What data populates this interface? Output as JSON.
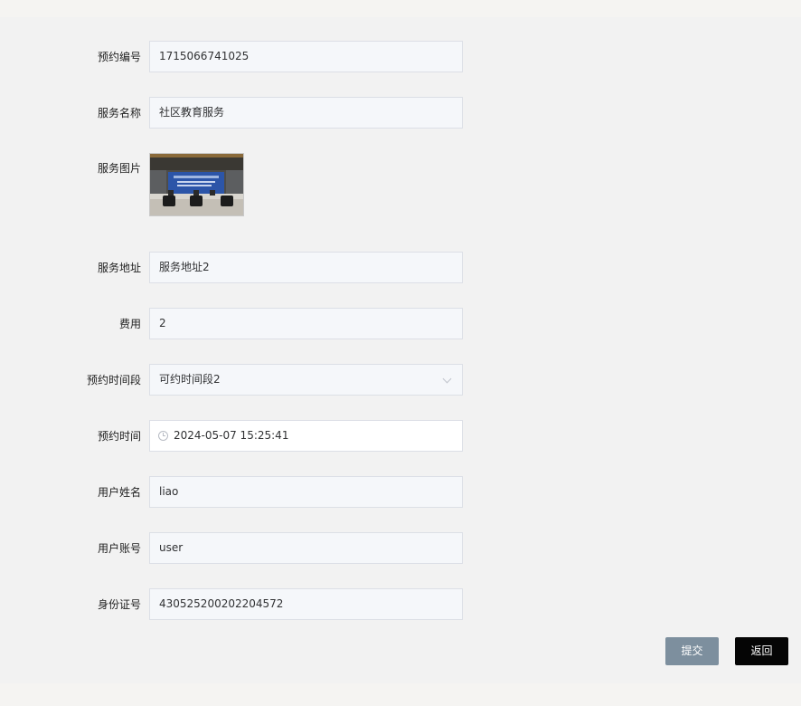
{
  "form": {
    "fields": [
      {
        "label": "预约编号",
        "value": "1715066741025"
      },
      {
        "label": "服务名称",
        "value": "社区教育服务"
      },
      {
        "label": "服务图片"
      },
      {
        "label": "服务地址",
        "value": "服务地址2"
      },
      {
        "label": "费用",
        "value": "2"
      },
      {
        "label": "预约时间段",
        "value": "可约时间段2"
      },
      {
        "label": "预约时间",
        "value": "2024-05-07 15:25:41"
      },
      {
        "label": "用户姓名",
        "value": "liao"
      },
      {
        "label": "用户账号",
        "value": "user"
      },
      {
        "label": "身份证号",
        "value": "430525200202204572"
      }
    ]
  },
  "actions": {
    "submit_label": "提交",
    "back_label": "返回"
  },
  "colors": {
    "submit": "#7d8f9e",
    "back": "#050505",
    "input_bg": "#f5f7fa",
    "input_border": "#dcdfe6"
  },
  "icons": {
    "time_picker": "clock-icon",
    "select": "chevron-down-icon"
  }
}
